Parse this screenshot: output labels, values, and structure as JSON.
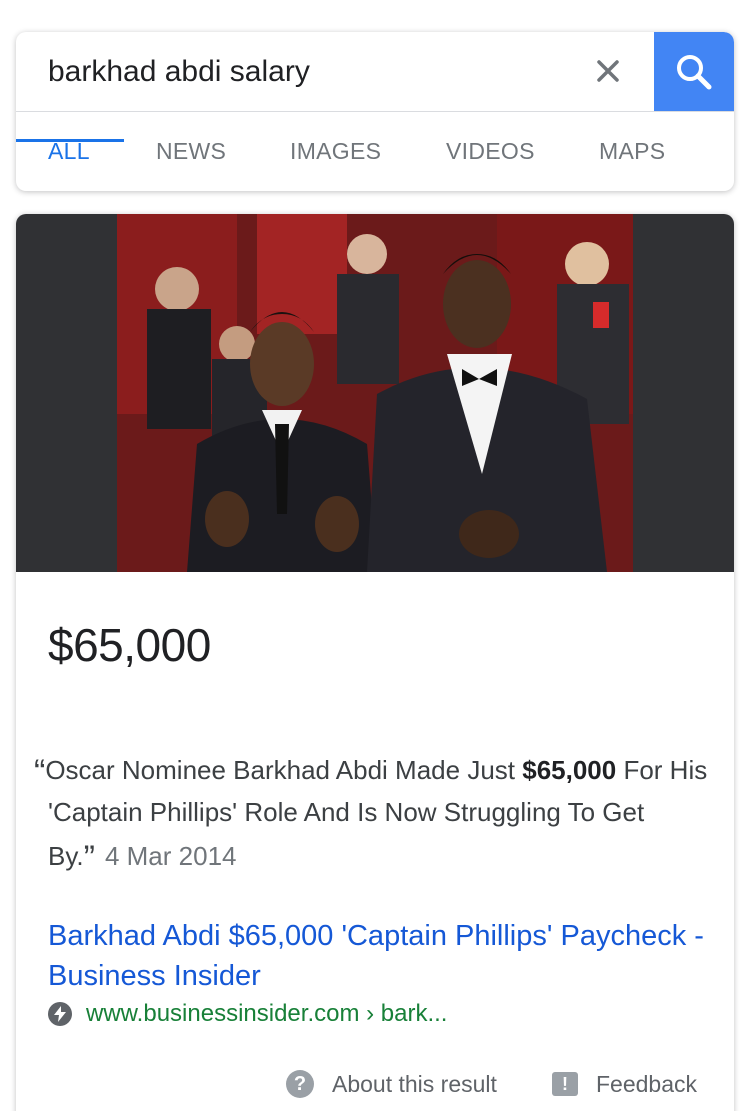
{
  "search": {
    "query": "barkhad abdi salary",
    "clear_icon": "close-icon",
    "search_icon": "search-icon"
  },
  "tabs": [
    {
      "label": "ALL",
      "active": true
    },
    {
      "label": "NEWS",
      "active": false
    },
    {
      "label": "IMAGES",
      "active": false
    },
    {
      "label": "VIDEOS",
      "active": false
    },
    {
      "label": "MAPS",
      "active": false
    }
  ],
  "result": {
    "answer": "$65,000",
    "snippet_part1": "Oscar Nominee Barkhad Abdi Made Just ",
    "snippet_bold": "$65,000",
    "snippet_part2": " For His 'Captain Phillips' Role And Is Now Struggling To Get By.",
    "date": "4 Mar 2014",
    "link_title": "Barkhad Abdi $65,000 'Captain Phillips' Paycheck - Business Insider",
    "url": "www.businessinsider.com › bark...",
    "amp_icon": "amp-lightning-icon"
  },
  "footer": {
    "about_label": "About this result",
    "feedback_label": "Feedback"
  },
  "colors": {
    "accent": "#1a73e8",
    "search_button": "#4285f4",
    "link": "#1558d6",
    "url": "#188038"
  }
}
